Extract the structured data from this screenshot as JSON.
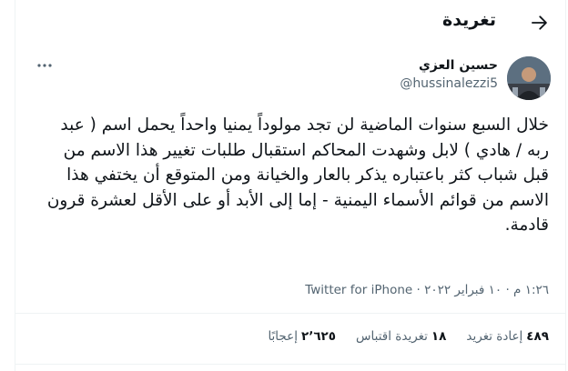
{
  "header": {
    "title": "تغريدة"
  },
  "author": {
    "name": "حسين العزي",
    "handle": "@hussinalezzi5"
  },
  "tweet": {
    "text": "خلال السبع سنوات الماضية لن تجد مولوداً يمنيا واحداً يحمل اسم ( عبد ربه / هادي ) لابل وشهدت المحاكم استقبال طلبات تغيير هذا الاسم من قبل شباب كثر باعتباره يذكر بالعار والخيانة ومن المتوقع أن يختفي هذا الاسم من قوائم الأسماء اليمنية - إما إلى الأبد أو على الأقل لعشرة قرون قادمة.",
    "time": "١:٢٦ م",
    "separator": "·",
    "date": "١٠ فبراير ٢٠٢٢",
    "source": "Twitter for iPhone"
  },
  "stats": {
    "retweets_count": "٤٨٩",
    "retweets_label": "إعادة تغريد",
    "quotes_count": "١٨",
    "quotes_label": "تغريدة اقتباس",
    "likes_count": "٢٬٦٢٥",
    "likes_label": "إعجابًا"
  },
  "icons": {
    "back": "back-arrow-icon",
    "more": "more-dots-icon"
  }
}
